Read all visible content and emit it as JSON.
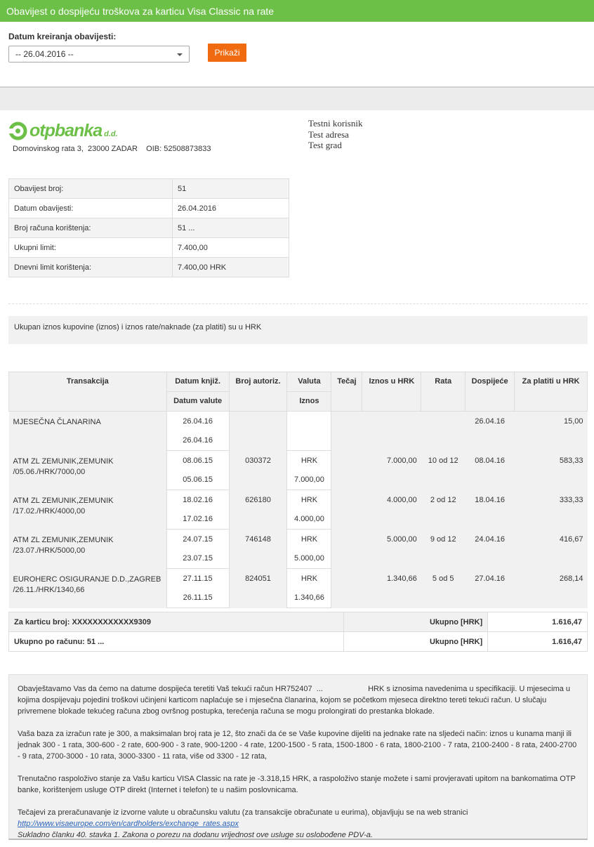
{
  "header": {
    "title": "Obavijest o dospijeću troškova za karticu Visa Classic na rate"
  },
  "filter": {
    "label": "Datum kreiranja obavijesti:",
    "selected": "-- 26.04.2016 --",
    "button": "Prikaži"
  },
  "bank": {
    "name": "otpbanka",
    "suffix": "d.d.",
    "address": "Domovinskog rata 3,  23000 ZADAR    OIB: 52508873833"
  },
  "recipient": {
    "name": "Testni korisnik",
    "address": "Test adresa",
    "city": "Test grad"
  },
  "info": [
    {
      "label": "Obavijest broj:",
      "value": "51"
    },
    {
      "label": "Datum obavijesti:",
      "value": "26.04.2016"
    },
    {
      "label": "Broj računa korištenja:",
      "value": "51 ..."
    },
    {
      "label": "Ukupni limit:",
      "value": "7.400,00"
    },
    {
      "label": "Dnevni limit korištenja:",
      "value": "7.400,00 HRK"
    }
  ],
  "currency_note": "Ukupan iznos kupovine (iznos) i iznos rate/naknade (za platiti) su u HRK",
  "table": {
    "headers": {
      "transakcija": "Transakcija",
      "datum_knjiz": "Datum knjiž.",
      "datum_valute": "Datum valute",
      "broj_autoriz": "Broj autoriz.",
      "valuta": "Valuta",
      "iznos": "Iznos",
      "tecaj": "Tečaj",
      "iznos_hrk": "Iznos u HRK",
      "rata": "Rata",
      "dospijece": "Dospijeće",
      "za_platiti": "Za platiti u HRK"
    },
    "rows": [
      {
        "desc1": "MJESEČNA ČLANARINA",
        "desc2": "",
        "datum_knjiz": "26.04.16",
        "datum_valute": "26.04.16",
        "autoriz": "",
        "valuta": "",
        "iznos": "",
        "tecaj": "",
        "iznos_hrk": "",
        "rata": "",
        "dospijece": "26.04.16",
        "za_platiti": "15,00"
      },
      {
        "desc1": "ATM ZL ZEMUNIK,ZEMUNIK",
        "desc2": "/05.06./HRK/7000,00",
        "datum_knjiz": "08.06.15",
        "datum_valute": "05.06.15",
        "autoriz": "030372",
        "valuta": "HRK",
        "iznos": "7.000,00",
        "tecaj": "",
        "iznos_hrk": "7.000,00",
        "rata": "10 od 12",
        "dospijece": "08.04.16",
        "za_platiti": "583,33"
      },
      {
        "desc1": "ATM ZL ZEMUNIK,ZEMUNIK",
        "desc2": "/17.02./HRK/4000,00",
        "datum_knjiz": "18.02.16",
        "datum_valute": "17.02.16",
        "autoriz": "626180",
        "valuta": "HRK",
        "iznos": "4.000,00",
        "tecaj": "",
        "iznos_hrk": "4.000,00",
        "rata": "2 od 12",
        "dospijece": "18.04.16",
        "za_platiti": "333,33"
      },
      {
        "desc1": "ATM ZL ZEMUNIK,ZEMUNIK",
        "desc2": "/23.07./HRK/5000,00",
        "datum_knjiz": "24.07.15",
        "datum_valute": "23.07.15",
        "autoriz": "746148",
        "valuta": "HRK",
        "iznos": "5.000,00",
        "tecaj": "",
        "iznos_hrk": "5.000,00",
        "rata": "9 od 12",
        "dospijece": "24.04.16",
        "za_platiti": "416,67"
      },
      {
        "desc1": "EUROHERC OSIGURANJE D.D.,ZAGREB",
        "desc2": "/26.11./HRK/1340,66",
        "datum_knjiz": "27.11.15",
        "datum_valute": "26.11.15",
        "autoriz": "824051",
        "valuta": "HRK",
        "iznos": "1.340,66",
        "tecaj": "",
        "iznos_hrk": "1.340,66",
        "rata": "5 od 5",
        "dospijece": "27.04.16",
        "za_platiti": "268,14"
      }
    ]
  },
  "totals": [
    {
      "label": "Za karticu broj: XXXXXXXXXXXX9309",
      "ukupno": "Ukupno [HRK]",
      "value": "1.616,47"
    },
    {
      "label": "Ukupno po računu: 51 ...",
      "ukupno": "Ukupno [HRK]",
      "value": "1.616,47"
    }
  ],
  "notice": {
    "p1": "Obavještavamo Vas da ćemo na datume dospijeća teretiti Vaš tekući račun HR752407  ...                     HRK s iznosima navedenima u specifikaciji. U mjesecima u kojima dospijevaju pojedini troškovi učinjeni karticom naplaćuje se i mjesečna članarina, kojom se početkom mjeseca direktno tereti tekući račun. U slučaju privremene blokade tekućeg računa zbog ovršnog postupka, terećenja računa se mogu prolongirati do prestanka blokade.",
    "p2": "Vaša baza za izračun rate je 300, a maksimalan broj rata je 12, što znači da će se Vaše kupovine dijeliti na jednake rate na sljedeći način: iznos u kunama manji ili jednak 300 - 1 rata, 300-600 - 2 rate, 600-900 - 3 rate, 900-1200 - 4 rate, 1200-1500 - 5 rata, 1500-1800 - 6 rata, 1800-2100 - 7 rata, 2100-2400 - 8 rata, 2400-2700 - 9 rata, 2700-3000 - 10 rata, 3000-3300 - 11 rata, više od 3300 - 12 rata,",
    "p3": "Trenutačno raspoloživo stanje za Vašu karticu VISA Classic na rate je -3.318,15 HRK, a raspoloživo stanje možete i sami provjeravati upitom na bankomatima OTP banke, korištenjem usluge OTP direkt (Internet i telefon) te u našim poslovnicama.",
    "p4": "Tečajevi za preračunavanje iz izvorne valute u obračunsku valutu (za transakcije obračunate u eurima), objavljuju se na web stranici",
    "link": "http://www.visaeurope.com/en/cardholders/exchange_rates.aspx",
    "p5": "Sukladno članku 40. stavka 1. Zakona o porezu na dodanu vrijednost ove usluge su oslobođene PDV-a."
  }
}
